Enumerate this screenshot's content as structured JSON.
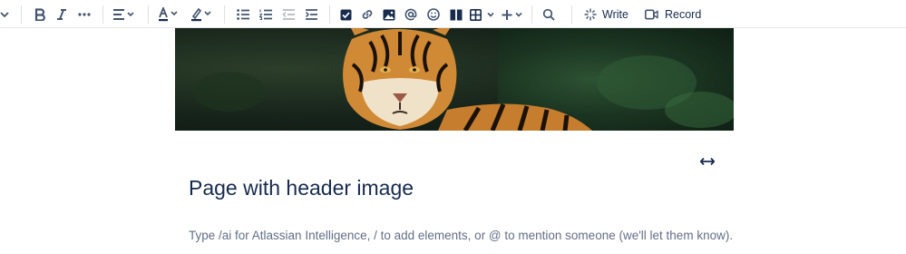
{
  "toolbar": {
    "write_label": "Write",
    "record_label": "Record",
    "icons": [
      "chevron-down-icon",
      "bold-icon",
      "italic-icon",
      "more-formatting-icon",
      "align-icon",
      "text-color-icon",
      "highlight-icon",
      "bullet-list-icon",
      "numbered-list-icon",
      "outdent-icon",
      "indent-icon",
      "task-icon",
      "link-icon",
      "image-icon",
      "mention-icon",
      "emoji-icon",
      "layout-icon",
      "table-icon",
      "insert-icon",
      "search-icon",
      "ai-sparkle-icon",
      "video-icon"
    ]
  },
  "page": {
    "title": "Page with header image",
    "placeholder": "Type /ai for Atlassian Intelligence, / to add elements, or @ to mention someone (we'll let them know)."
  }
}
